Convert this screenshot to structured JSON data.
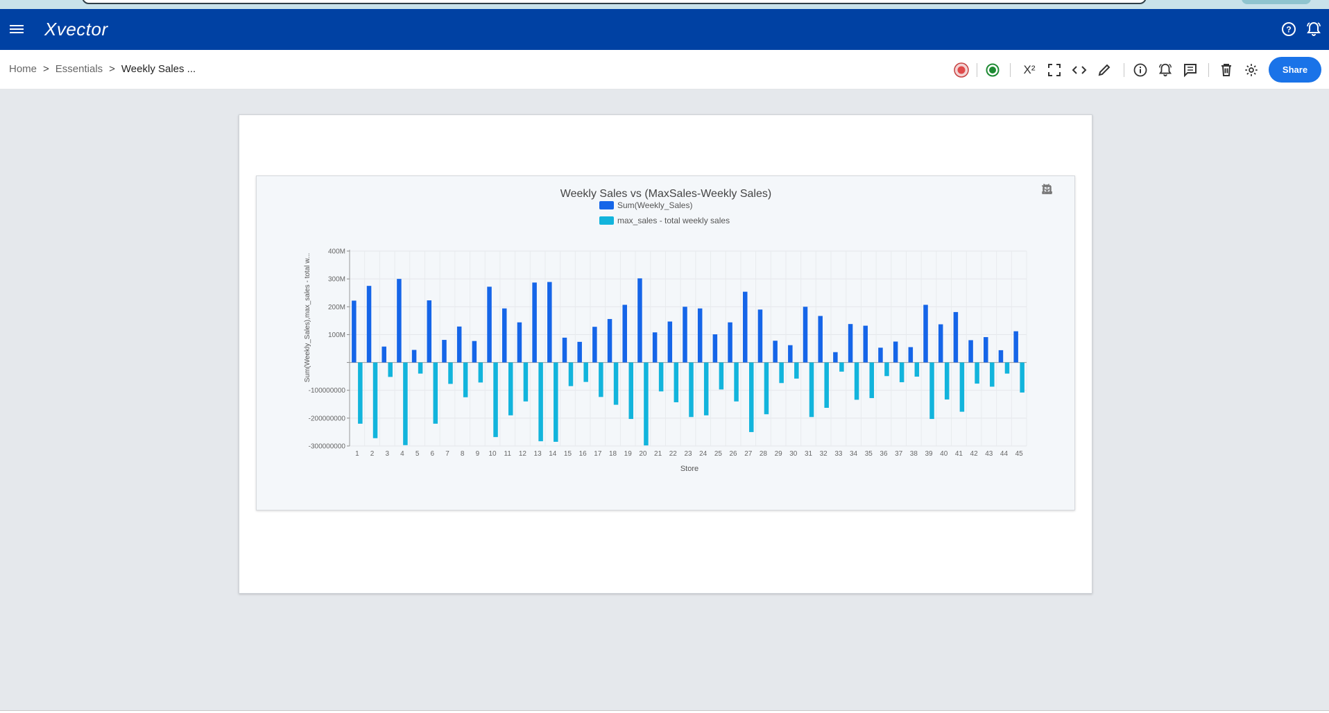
{
  "app": {
    "logo": "Xvector"
  },
  "breadcrumb": {
    "items": [
      "Home",
      "Essentials",
      "Weekly Sales ..."
    ],
    "separator": ">"
  },
  "toolbar": {
    "share_label": "Share",
    "superscript_label": "X²",
    "icons": [
      "record-badge-icon",
      "status-live-icon",
      "superscript-icon",
      "fullscreen-icon",
      "code-icon",
      "edit-icon",
      "info-icon",
      "alert-bell-icon",
      "comment-icon",
      "delete-icon",
      "settings-icon"
    ]
  },
  "colors": {
    "brand": "#0041a3",
    "accent": "#1a73e8",
    "series1": "#1565e8",
    "series2": "#12b4dc"
  },
  "chart_data": {
    "type": "bar",
    "title": "Weekly Sales vs (MaxSales-Weekly Sales)",
    "xlabel": "Store",
    "ylabel": "Sum(Weekly_Sales),max_sales - total w...",
    "legend_position": "top-center",
    "grid": true,
    "ylim": [
      -300000000,
      400000000
    ],
    "y_ticks": [
      {
        "value": 400000000,
        "label": "400M"
      },
      {
        "value": 300000000,
        "label": "300M"
      },
      {
        "value": 200000000,
        "label": "200M"
      },
      {
        "value": 100000000,
        "label": "100M"
      },
      {
        "value": 0,
        "label": ""
      },
      {
        "value": -100000000,
        "label": "-100000000"
      },
      {
        "value": -200000000,
        "label": "-200000000"
      },
      {
        "value": -300000000,
        "label": "-300000000"
      }
    ],
    "categories": [
      "1",
      "2",
      "3",
      "4",
      "5",
      "6",
      "7",
      "8",
      "9",
      "10",
      "11",
      "12",
      "13",
      "14",
      "15",
      "16",
      "17",
      "18",
      "19",
      "20",
      "21",
      "22",
      "23",
      "24",
      "25",
      "26",
      "27",
      "28",
      "29",
      "30",
      "31",
      "32",
      "33",
      "34",
      "35",
      "36",
      "37",
      "38",
      "39",
      "40",
      "41",
      "42",
      "43",
      "44",
      "45"
    ],
    "series": [
      {
        "name": "Sum(Weekly_Sales)",
        "color": "#1565e8",
        "values": [
          222000000,
          275000000,
          57000000,
          300000000,
          45000000,
          223000000,
          81000000,
          129000000,
          77000000,
          272000000,
          194000000,
          144000000,
          287000000,
          289000000,
          89000000,
          74000000,
          128000000,
          156000000,
          207000000,
          302000000,
          108000000,
          147000000,
          200000000,
          194000000,
          101000000,
          144000000,
          254000000,
          190000000,
          78000000,
          62000000,
          200000000,
          167000000,
          37000000,
          138000000,
          132000000,
          53000000,
          75000000,
          55000000,
          207000000,
          137000000,
          181000000,
          80000000,
          91000000,
          44000000,
          112000000
        ]
      },
      {
        "name": "max_sales - total weekly sales",
        "color": "#12b4dc",
        "values": [
          -220000000,
          -272000000,
          -52000000,
          -297000000,
          -40000000,
          -220000000,
          -77000000,
          -125000000,
          -72000000,
          -268000000,
          -190000000,
          -140000000,
          -283000000,
          -285000000,
          -85000000,
          -70000000,
          -124000000,
          -152000000,
          -203000000,
          -298000000,
          -104000000,
          -143000000,
          -196000000,
          -190000000,
          -97000000,
          -140000000,
          -250000000,
          -186000000,
          -74000000,
          -58000000,
          -196000000,
          -163000000,
          -33000000,
          -134000000,
          -128000000,
          -49000000,
          -71000000,
          -51000000,
          -203000000,
          -133000000,
          -177000000,
          -76000000,
          -87000000,
          -40000000,
          -108000000
        ]
      }
    ]
  }
}
